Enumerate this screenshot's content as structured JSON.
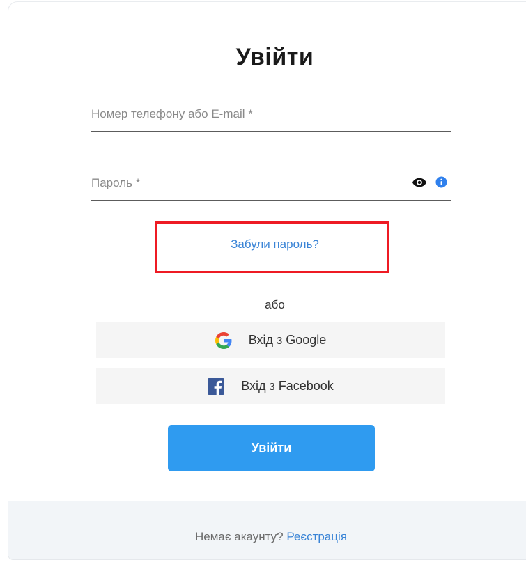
{
  "login": {
    "title": "Увійти",
    "phone_placeholder": "Номер телефону або E-mail *",
    "phone_value": "",
    "password_placeholder": "Пароль *",
    "password_value": "",
    "show_password_icon": "eye-icon",
    "password_info_icon": "info-icon",
    "forgot_password_label": "Забули пароль?",
    "or_label": "або",
    "google_label": "Вхід з Google",
    "facebook_label": "Вхід з Facebook",
    "submit_label": "Увійти"
  },
  "footer": {
    "no_account_text": "Немає акаунту?",
    "register_label": "Реєстрація"
  },
  "colors": {
    "accent": "#2f9bf0",
    "link": "#3a84d6",
    "highlight_box": "#ee1b24",
    "footer_bg": "#f2f5f8",
    "social_bg": "#f5f5f5",
    "facebook_blue": "#3b5998"
  }
}
